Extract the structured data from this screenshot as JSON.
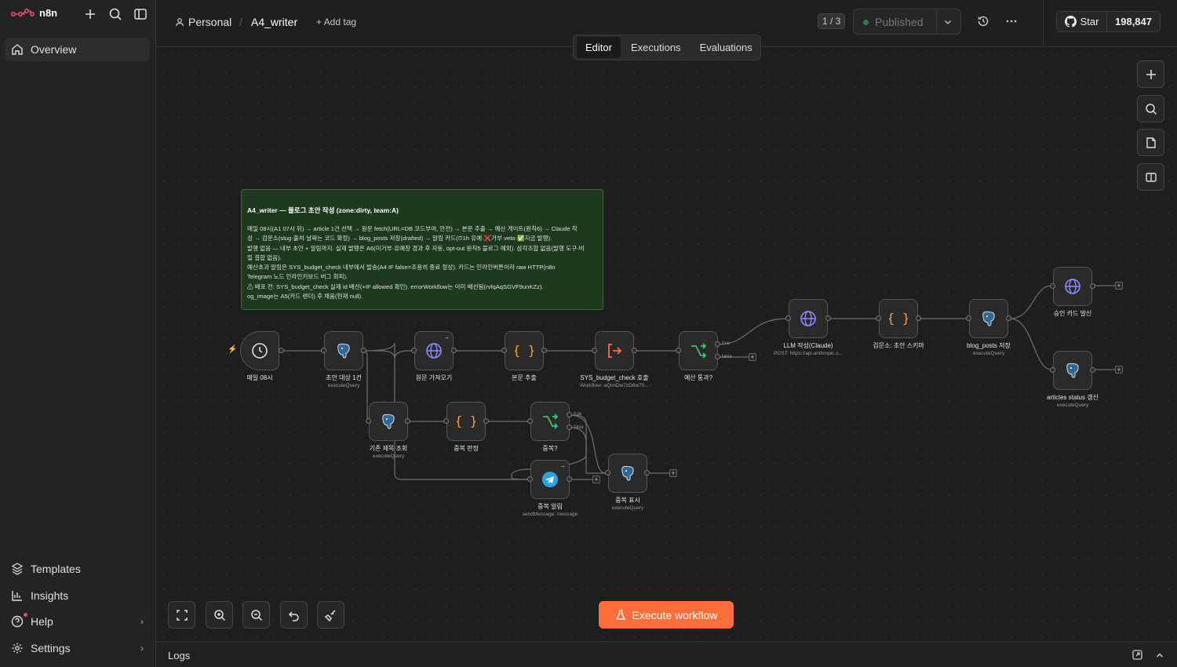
{
  "app": {
    "name": "n8n"
  },
  "sidebar": {
    "overview": "Overview",
    "bottom_items": [
      {
        "label": "Templates",
        "icon": "templates-icon"
      },
      {
        "label": "Insights",
        "icon": "chart-icon"
      },
      {
        "label": "Help",
        "icon": "help-icon"
      },
      {
        "label": "Settings",
        "icon": "gear-icon"
      }
    ]
  },
  "header": {
    "project": "Personal",
    "workflow_name": "A4_writer",
    "add_tag": "+ Add tag",
    "version": "1 / 3",
    "publish_status": "Published",
    "github_star": "Star",
    "github_count": "198,847"
  },
  "tabs": [
    "Editor",
    "Executions",
    "Evaluations"
  ],
  "sticky": {
    "title": "A4_writer — 블로그 초안 작성 (zone:dirty, team:A)",
    "lines": [
      "매일 08시(A1 07시 뒤) → article 1건 선택 → 원문 fetch(URL=DB 코드부여, 안전) → 본문 추출 → 예산 게이트(원칙6) → Claude 작",
      "성 → 검문소(slug·출처·날짜는 코드 확정) → blog_posts 저장(drafted) → 알림 카드(⏱1h 유예·❌거부 veto·✅지금 발행).",
      "발행 없음 — 내부 초안 + 알림까지. 실제 발행은 A6(미거부·유예창 경과 후 자동, opt-out 원칙5 블로그 예외). 삼각조합 없음(발행 도구·비",
      "밀 결합 없음).",
      "예산초과 알림은 SYS_budget_check 내부에서 발송(A4 IF false=조용히 종료 정상). 카드는 인라인버튼이라 raw HTTP(n8n",
      "Telegram 노드 인라인키보드 버그 회피).",
      "⚠ 배포 전: SYS_budget_check 실제 id 배선(+IF allowed 확인). errorWorkflow는 이미 배선됨(rvfqAqSGVF9unKZz).",
      "og_image는 A5(카드 렌더) 후 채움(현재 null)."
    ]
  },
  "nodes": {
    "schedule": {
      "label": "매일 08시",
      "sub": ""
    },
    "draft_target": {
      "label": "초안 대상 1건",
      "sub": "executeQuery"
    },
    "fetch_source": {
      "label": "원문 가져오기",
      "sub": ""
    },
    "extract_body": {
      "label": "본문 추출",
      "sub": ""
    },
    "budget_check": {
      "label": "SYS_budget_check 호출",
      "sub": "Workflow: aQlmDw7zD6w70..."
    },
    "budget_pass": {
      "label": "예산 통과?",
      "sub": ""
    },
    "llm_write": {
      "label": "LLM 작성(Claude)",
      "sub": "POST: https://api.anthropic.c..."
    },
    "schema_check": {
      "label": "검문소: 초안 스키마",
      "sub": ""
    },
    "save_posts": {
      "label": "blog_posts 저장",
      "sub": "executeQuery"
    },
    "approval_card": {
      "label": "승인 카드 발신",
      "sub": ""
    },
    "status_update": {
      "label": "articles status 갱신",
      "sub": "executeQuery"
    },
    "existing_titles": {
      "label": "기존 제목 조회",
      "sub": "executeQuery"
    },
    "dup_judge": {
      "label": "중복 판정",
      "sub": ""
    },
    "dup_check": {
      "label": "중복?",
      "sub": ""
    },
    "dup_alert": {
      "label": "중복 알림",
      "sub": "sendMessage: message"
    },
    "dup_mark": {
      "label": "중복 표시",
      "sub": "executeQuery"
    }
  },
  "branch_labels": {
    "true": "true",
    "false": "false"
  },
  "execute_button": "Execute workflow",
  "logs": {
    "label": "Logs"
  },
  "colors": {
    "accent": "#ff6d3a",
    "sticky_bg": "#1d3a1f",
    "node_bg": "#2a2a2a"
  }
}
